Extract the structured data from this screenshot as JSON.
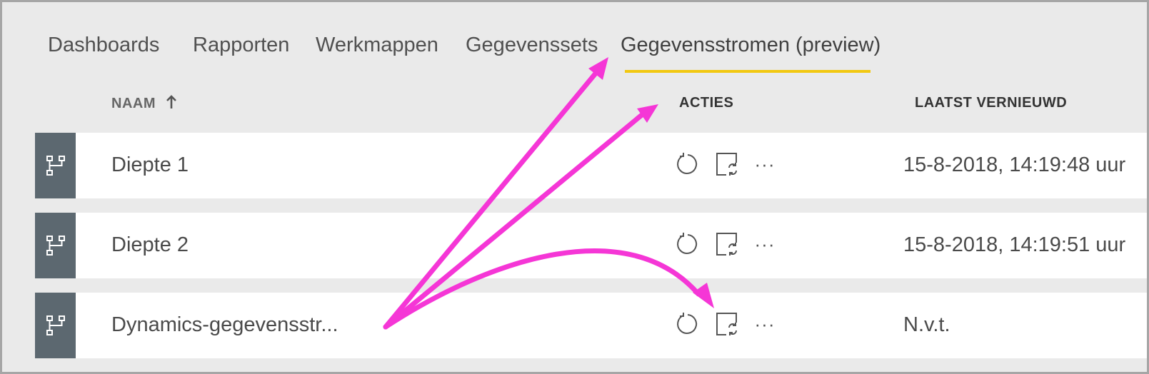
{
  "tabs": [
    {
      "label": "Dashboards"
    },
    {
      "label": "Rapporten"
    },
    {
      "label": "Werkmappen"
    },
    {
      "label": "Gegevenssets"
    },
    {
      "label": "Gegevensstromen (preview)",
      "active": true
    }
  ],
  "columns": {
    "name": "NAAM",
    "actions": "ACTIES",
    "last_refreshed": "LAATST VERNIEUWD"
  },
  "rows": [
    {
      "name": "Diepte 1",
      "last_refreshed": "15-8-2018, 14:19:48 uur",
      "icon": "dataflow-icon"
    },
    {
      "name": "Diepte 2",
      "last_refreshed": "15-8-2018, 14:19:51 uur",
      "icon": "dataflow-icon"
    },
    {
      "name": "Dynamics-gegevensstr...",
      "last_refreshed": "N.v.t.",
      "icon": "dataflow-icon"
    }
  ],
  "action_icons": [
    "refresh-icon",
    "schedule-refresh-icon",
    "more-options-icon"
  ],
  "more_glyph": "···",
  "colors": {
    "accent_underline": "#f2c811",
    "annotation_arrow": "#f536d6",
    "row_icon_bg": "#5c6870",
    "background": "#eaeaea"
  }
}
